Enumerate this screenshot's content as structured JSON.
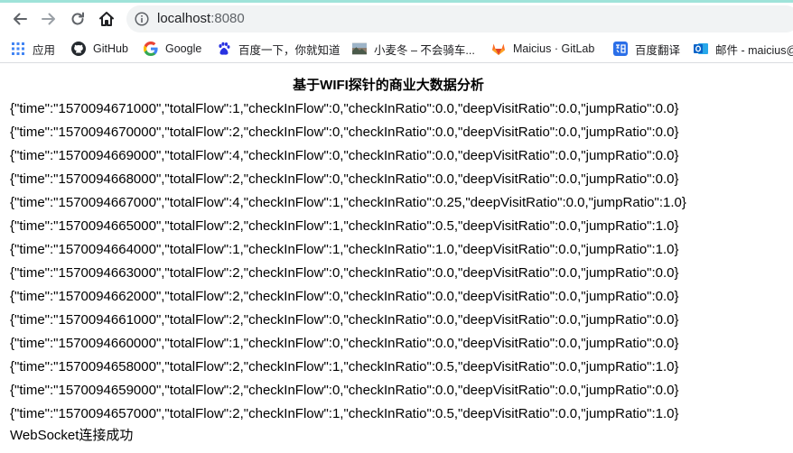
{
  "browser": {
    "url_host": "localhost",
    "url_port": ":8080"
  },
  "bookmarks": [
    {
      "label": "应用",
      "icon": "apps-grid-icon"
    },
    {
      "label": "GitHub",
      "icon": "github-icon"
    },
    {
      "label": "Google",
      "icon": "google-icon"
    },
    {
      "label": "百度一下，你就知道",
      "icon": "baidu-paw-icon"
    },
    {
      "label": "小麦冬 – 不会骑车...",
      "icon": "landscape-thumbnail-icon"
    },
    {
      "label": "Maicius · GitLab",
      "icon": "gitlab-icon"
    },
    {
      "label": "百度翻译",
      "icon": "baidu-translate-icon"
    },
    {
      "label": "邮件 - maicius@",
      "icon": "outlook-icon"
    }
  ],
  "page": {
    "title": "基于WIFI探针的商业大数据分析",
    "messages": [
      "{\"time\":\"1570094671000\",\"totalFlow\":1,\"checkInFlow\":0,\"checkInRatio\":0.0,\"deepVisitRatio\":0.0,\"jumpRatio\":0.0}",
      "{\"time\":\"1570094670000\",\"totalFlow\":2,\"checkInFlow\":0,\"checkInRatio\":0.0,\"deepVisitRatio\":0.0,\"jumpRatio\":0.0}",
      "{\"time\":\"1570094669000\",\"totalFlow\":4,\"checkInFlow\":0,\"checkInRatio\":0.0,\"deepVisitRatio\":0.0,\"jumpRatio\":0.0}",
      "{\"time\":\"1570094668000\",\"totalFlow\":2,\"checkInFlow\":0,\"checkInRatio\":0.0,\"deepVisitRatio\":0.0,\"jumpRatio\":0.0}",
      "{\"time\":\"1570094667000\",\"totalFlow\":4,\"checkInFlow\":1,\"checkInRatio\":0.25,\"deepVisitRatio\":0.0,\"jumpRatio\":1.0}",
      "{\"time\":\"1570094665000\",\"totalFlow\":2,\"checkInFlow\":1,\"checkInRatio\":0.5,\"deepVisitRatio\":0.0,\"jumpRatio\":1.0}",
      "{\"time\":\"1570094664000\",\"totalFlow\":1,\"checkInFlow\":1,\"checkInRatio\":1.0,\"deepVisitRatio\":0.0,\"jumpRatio\":1.0}",
      "{\"time\":\"1570094663000\",\"totalFlow\":2,\"checkInFlow\":0,\"checkInRatio\":0.0,\"deepVisitRatio\":0.0,\"jumpRatio\":0.0}",
      "{\"time\":\"1570094662000\",\"totalFlow\":2,\"checkInFlow\":0,\"checkInRatio\":0.0,\"deepVisitRatio\":0.0,\"jumpRatio\":0.0}",
      "{\"time\":\"1570094661000\",\"totalFlow\":2,\"checkInFlow\":0,\"checkInRatio\":0.0,\"deepVisitRatio\":0.0,\"jumpRatio\":0.0}",
      "{\"time\":\"1570094660000\",\"totalFlow\":1,\"checkInFlow\":0,\"checkInRatio\":0.0,\"deepVisitRatio\":0.0,\"jumpRatio\":0.0}",
      "{\"time\":\"1570094658000\",\"totalFlow\":2,\"checkInFlow\":1,\"checkInRatio\":0.5,\"deepVisitRatio\":0.0,\"jumpRatio\":1.0}",
      "{\"time\":\"1570094659000\",\"totalFlow\":2,\"checkInFlow\":0,\"checkInRatio\":0.0,\"deepVisitRatio\":0.0,\"jumpRatio\":0.0}",
      "{\"time\":\"1570094657000\",\"totalFlow\":2,\"checkInFlow\":1,\"checkInRatio\":0.5,\"deepVisitRatio\":0.0,\"jumpRatio\":1.0}"
    ],
    "status": "WebSocket连接成功"
  },
  "colors": {
    "tab_strip": "#9fe3d9",
    "omnibox_bg": "#f1f3f4",
    "icon_gray": "#5f6368",
    "github": "#24292e",
    "google_blue": "#4285f4",
    "baidu_blue": "#2932e1",
    "gitlab_orange": "#fc6d26",
    "translate_blue": "#2b6fe8",
    "outlook_blue": "#0a64c8"
  }
}
